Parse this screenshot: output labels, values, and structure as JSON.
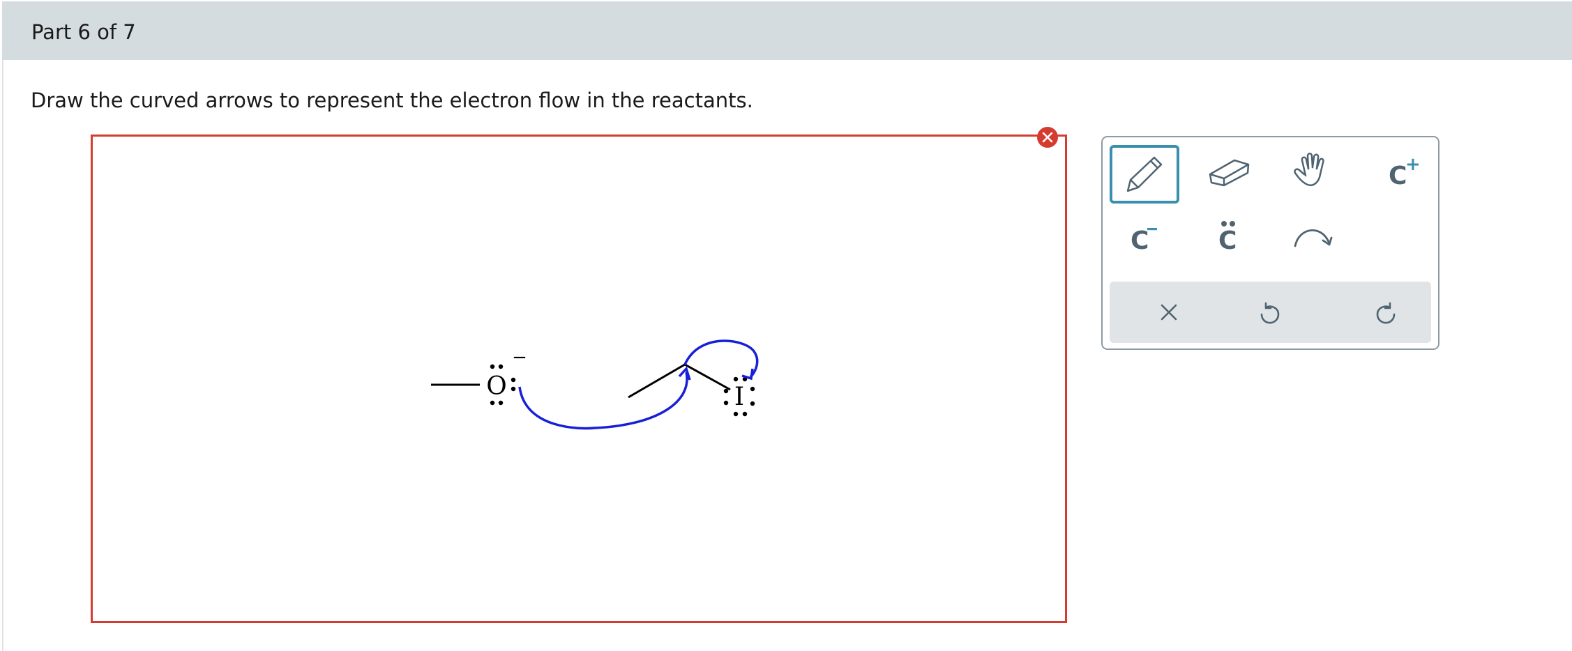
{
  "part": {
    "title": "Part 6 of 7"
  },
  "question": {
    "prompt": "Draw the curved arrows to represent the electron flow in the reactants."
  },
  "molecule": {
    "oxygen": {
      "symbol": "O",
      "charge": "−"
    },
    "iodine": {
      "symbol": "I"
    },
    "arrow_color": "#1720d6"
  },
  "toolbar": {
    "accent_color": "#3a8fae",
    "icon_color": "#4f6470",
    "tools": [
      {
        "name": "pencil-icon",
        "selected": true
      },
      {
        "name": "eraser-icon",
        "selected": false
      },
      {
        "name": "hand-icon",
        "selected": false
      },
      {
        "name": "carbocation-icon",
        "label": "C",
        "superscript": "+"
      },
      {
        "name": "carbanion-icon",
        "label": "C",
        "superscript": "−"
      },
      {
        "name": "lone-pair-icon",
        "label": "C"
      },
      {
        "name": "curved-arrow-icon"
      }
    ],
    "actions": [
      {
        "name": "clear-icon"
      },
      {
        "name": "undo-icon"
      },
      {
        "name": "redo-icon"
      }
    ]
  }
}
